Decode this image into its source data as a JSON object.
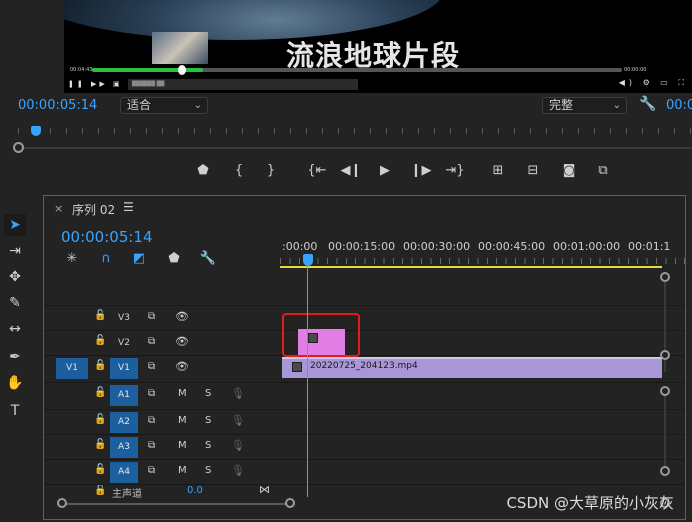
{
  "program_monitor": {
    "video_title": "流浪地球片段",
    "video_time_left": "00:04:43",
    "video_time_right": "00:00:00",
    "video_progress": 0.21,
    "video_search_placeholder": "██████ ██",
    "timecode": "00:00:05:14",
    "fit_dropdown": "适合",
    "resolution_dropdown": "完整",
    "truncated_timecode": "00:0"
  },
  "transport": {
    "marker": "marker",
    "in": "mark-in",
    "out": "mark-out",
    "goto_in": "go-to-in",
    "step_back": "step-back",
    "play": "play",
    "step_forward": "step-forward",
    "goto_out": "go-to-out",
    "lift": "lift",
    "extract": "extract",
    "export_frame": "export-frame",
    "compare": "compare"
  },
  "timeline": {
    "tab_label": "序列 02",
    "timecode": "00:00:05:14",
    "ruler_labels": [
      ":00:00",
      "00:00:15:00",
      "00:00:30:00",
      "00:00:45:00",
      "00:01:00:00",
      "00:01:1"
    ],
    "tracks": [
      {
        "name": "V3",
        "source": "",
        "type": "video"
      },
      {
        "name": "V2",
        "source": "",
        "type": "video"
      },
      {
        "name": "V1",
        "source": "V1",
        "type": "video"
      },
      {
        "name": "A1",
        "source": "",
        "type": "audio"
      },
      {
        "name": "A2",
        "source": "",
        "type": "audio"
      },
      {
        "name": "A3",
        "source": "",
        "type": "audio"
      },
      {
        "name": "A4",
        "source": "",
        "type": "audio"
      }
    ],
    "master_label": "主声道",
    "master_value": "0.0",
    "clip_v1_name": "20220725_204123.mp4",
    "mute_label": "M",
    "solo_label": "S"
  },
  "watermark": "CSDN @大草原的小灰灰",
  "colors": {
    "accent": "#3aa3ff",
    "clip_v1": "#a996d6",
    "clip_v2": "#e17de3",
    "highlight": "#e01c1c",
    "work_area": "#e9d93a"
  }
}
